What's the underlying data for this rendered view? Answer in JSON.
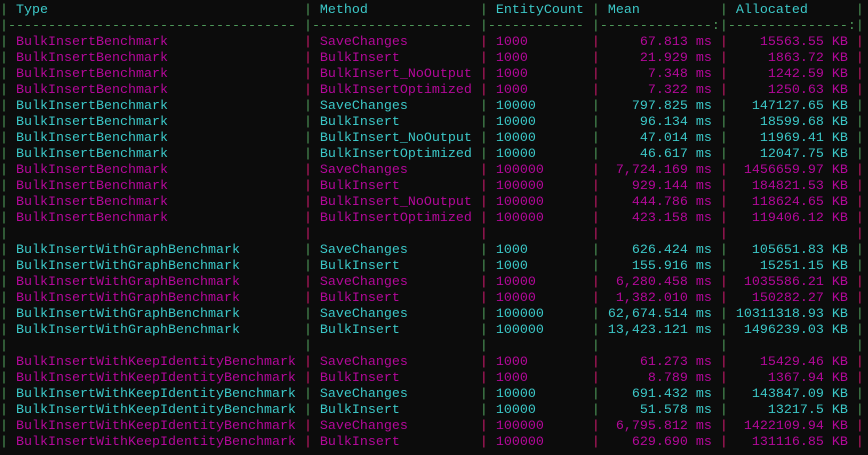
{
  "colors": {
    "background": "#0c0c0c",
    "cyan": "#3cc8c8",
    "magenta": "#b4089a",
    "pipe_green": "#4e9a5a",
    "pipe_pink": "#c8186a"
  },
  "table": {
    "headers": [
      "Type",
      "Method",
      "EntityCount",
      "Mean",
      "Allocated"
    ],
    "rows": [
      {
        "color": "mag",
        "cells": [
          "BulkInsertBenchmark",
          "SaveChanges",
          "1000",
          "67.813 ms",
          "15563.55 KB"
        ]
      },
      {
        "color": "mag",
        "cells": [
          "BulkInsertBenchmark",
          "BulkInsert",
          "1000",
          "21.929 ms",
          "1863.72 KB"
        ]
      },
      {
        "color": "mag",
        "cells": [
          "BulkInsertBenchmark",
          "BulkInsert_NoOutput",
          "1000",
          "7.348 ms",
          "1242.59 KB"
        ]
      },
      {
        "color": "mag",
        "cells": [
          "BulkInsertBenchmark",
          "BulkInsertOptimized",
          "1000",
          "7.322 ms",
          "1250.63 KB"
        ]
      },
      {
        "color": "cyan",
        "cells": [
          "BulkInsertBenchmark",
          "SaveChanges",
          "10000",
          "797.825 ms",
          "147127.65 KB"
        ]
      },
      {
        "color": "cyan",
        "cells": [
          "BulkInsertBenchmark",
          "BulkInsert",
          "10000",
          "96.134 ms",
          "18599.68 KB"
        ]
      },
      {
        "color": "cyan",
        "cells": [
          "BulkInsertBenchmark",
          "BulkInsert_NoOutput",
          "10000",
          "47.014 ms",
          "11969.41 KB"
        ]
      },
      {
        "color": "cyan",
        "cells": [
          "BulkInsertBenchmark",
          "BulkInsertOptimized",
          "10000",
          "46.617 ms",
          "12047.75 KB"
        ]
      },
      {
        "color": "mag",
        "cells": [
          "BulkInsertBenchmark",
          "SaveChanges",
          "100000",
          "7,724.169 ms",
          "1456659.97 KB"
        ]
      },
      {
        "color": "mag",
        "cells": [
          "BulkInsertBenchmark",
          "BulkInsert",
          "100000",
          "929.144 ms",
          "184821.53 KB"
        ]
      },
      {
        "color": "mag",
        "cells": [
          "BulkInsertBenchmark",
          "BulkInsert_NoOutput",
          "100000",
          "444.786 ms",
          "118624.65 KB"
        ]
      },
      {
        "color": "mag",
        "cells": [
          "BulkInsertBenchmark",
          "BulkInsertOptimized",
          "100000",
          "423.158 ms",
          "119406.12 KB"
        ]
      },
      {
        "color": "mag",
        "cells": [
          "",
          "",
          "",
          "",
          ""
        ]
      },
      {
        "color": "cyan",
        "cells": [
          "BulkInsertWithGraphBenchmark",
          "SaveChanges",
          "1000",
          "626.424 ms",
          "105651.83 KB"
        ]
      },
      {
        "color": "cyan",
        "cells": [
          "BulkInsertWithGraphBenchmark",
          "BulkInsert",
          "1000",
          "155.916 ms",
          "15251.15 KB"
        ]
      },
      {
        "color": "mag",
        "cells": [
          "BulkInsertWithGraphBenchmark",
          "SaveChanges",
          "10000",
          "6,280.458 ms",
          "1035586.21 KB"
        ]
      },
      {
        "color": "mag",
        "cells": [
          "BulkInsertWithGraphBenchmark",
          "BulkInsert",
          "10000",
          "1,382.010 ms",
          "150282.27 KB"
        ]
      },
      {
        "color": "cyan",
        "cells": [
          "BulkInsertWithGraphBenchmark",
          "SaveChanges",
          "100000",
          "62,674.514 ms",
          "10311318.93 KB"
        ]
      },
      {
        "color": "cyan",
        "cells": [
          "BulkInsertWithGraphBenchmark",
          "BulkInsert",
          "100000",
          "13,423.121 ms",
          "1496239.03 KB"
        ]
      },
      {
        "color": "cyan",
        "cells": [
          "",
          "",
          "",
          "",
          ""
        ]
      },
      {
        "color": "mag",
        "cells": [
          "BulkInsertWithKeepIdentityBenchmark",
          "SaveChanges",
          "1000",
          "61.273 ms",
          "15429.46 KB"
        ]
      },
      {
        "color": "mag",
        "cells": [
          "BulkInsertWithKeepIdentityBenchmark",
          "BulkInsert",
          "1000",
          "8.789 ms",
          "1367.94 KB"
        ]
      },
      {
        "color": "cyan",
        "cells": [
          "BulkInsertWithKeepIdentityBenchmark",
          "SaveChanges",
          "10000",
          "691.432 ms",
          "143847.09 KB"
        ]
      },
      {
        "color": "cyan",
        "cells": [
          "BulkInsertWithKeepIdentityBenchmark",
          "BulkInsert",
          "10000",
          "51.578 ms",
          "13217.5 KB"
        ]
      },
      {
        "color": "mag",
        "cells": [
          "BulkInsertWithKeepIdentityBenchmark",
          "SaveChanges",
          "100000",
          "6,795.812 ms",
          "1422109.94 KB"
        ]
      },
      {
        "color": "mag",
        "cells": [
          "BulkInsertWithKeepIdentityBenchmark",
          "BulkInsert",
          "100000",
          "629.690 ms",
          "131116.85 KB"
        ]
      }
    ]
  }
}
